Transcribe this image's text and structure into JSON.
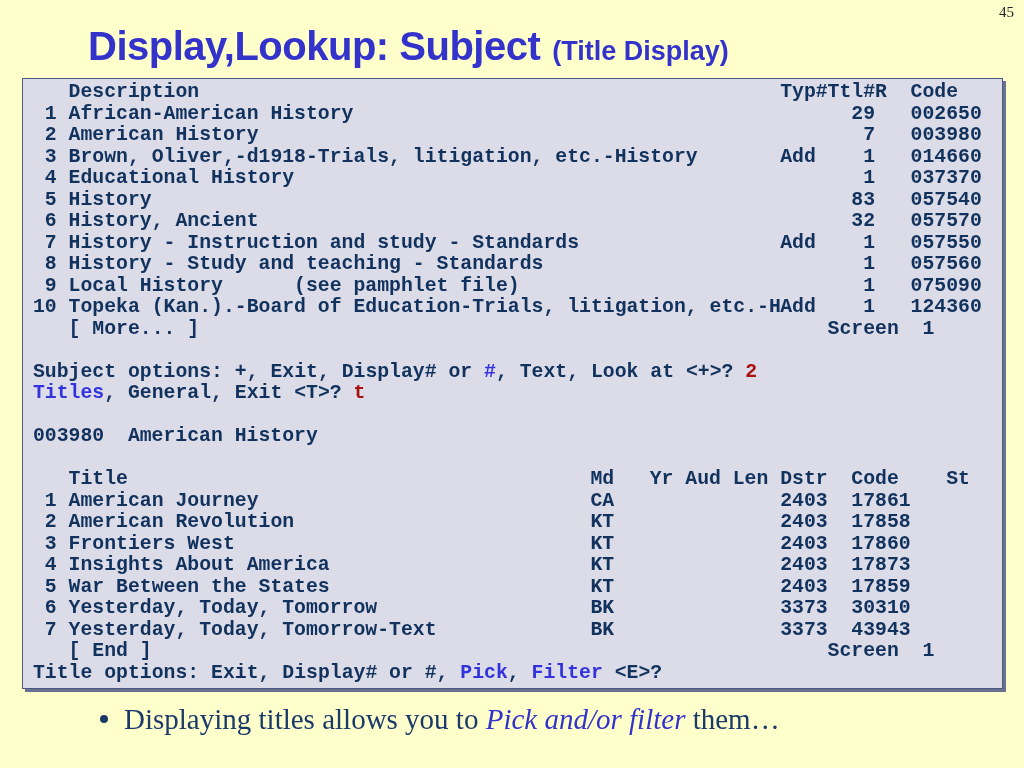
{
  "slide": {
    "page_number": "45",
    "title": "Display,Lookup: Subject",
    "subtitle": "(Title Display)"
  },
  "terminal": {
    "subject_table": {
      "columns": [
        "Description",
        "Typ",
        "#Ttl#R",
        "Code"
      ],
      "rows": [
        {
          "number": "1",
          "description": "African-American History",
          "titles": "29",
          "code": "002650"
        },
        {
          "number": "2",
          "description": "American History",
          "titles": "7",
          "code": "003980"
        },
        {
          "number": "3",
          "description": "Brown, Oliver,-d1918-Trials, litigation, etc.-History",
          "type": "Add",
          "titles": "1",
          "code": "014660"
        },
        {
          "number": "4",
          "description": "Educational History",
          "titles": "1",
          "code": "037370"
        },
        {
          "number": "5",
          "description": "History",
          "titles": "83",
          "code": "057540"
        },
        {
          "number": "6",
          "description": "History, Ancient",
          "titles": "32",
          "code": "057570"
        },
        {
          "number": "7",
          "description": "History - Instruction and study - Standards",
          "type": "Add",
          "titles": "1",
          "code": "057550"
        },
        {
          "number": "8",
          "description": "History - Study and teaching - Standards",
          "titles": "1",
          "code": "057560"
        },
        {
          "number": "9",
          "description": "Local History      (see pamphlet file)",
          "titles": "1",
          "code": "075090"
        },
        {
          "number": "10",
          "description": "Topeka (Kan.).-Board of Education-Trials, litigation, etc.-H",
          "type": "Add",
          "titles": "1",
          "code": "124360"
        }
      ],
      "footer": "[ More... ]",
      "screen_label": "Screen",
      "screen_number": "1"
    },
    "subject_prompt": [
      {
        "kind": "text",
        "text": "Subject options: +, Exit, Display# or "
      },
      {
        "kind": "option",
        "text": "#"
      },
      {
        "kind": "text",
        "text": ", Text, Look at <+>? "
      },
      {
        "kind": "input",
        "text": "2"
      }
    ],
    "view_prompt": [
      {
        "kind": "option",
        "text": "Titles"
      },
      {
        "kind": "text",
        "text": ", General, Exit <T>? "
      },
      {
        "kind": "input",
        "text": "t"
      }
    ],
    "selected_subject": {
      "code": "003980",
      "name": "American History"
    },
    "titles_table": {
      "columns": [
        "Title",
        "Md",
        "Yr",
        "Aud",
        "Len",
        "Dstr",
        "Code",
        "St"
      ],
      "rows": [
        {
          "number": "1",
          "title": "American Journey",
          "md": "CA",
          "dstr": "2403",
          "code": "17861"
        },
        {
          "number": "2",
          "title": "American Revolution",
          "md": "KT",
          "dstr": "2403",
          "code": "17858"
        },
        {
          "number": "3",
          "title": "Frontiers West",
          "md": "KT",
          "dstr": "2403",
          "code": "17860"
        },
        {
          "number": "4",
          "title": "Insights About America",
          "md": "KT",
          "dstr": "2403",
          "code": "17873"
        },
        {
          "number": "5",
          "title": "War Between the States",
          "md": "KT",
          "dstr": "2403",
          "code": "17859"
        },
        {
          "number": "6",
          "title": "Yesterday, Today, Tomorrow",
          "md": "BK",
          "dstr": "3373",
          "code": "30310"
        },
        {
          "number": "7",
          "title": "Yesterday, Today, Tomorrow-Text",
          "md": "BK",
          "dstr": "3373",
          "code": "43943"
        }
      ],
      "footer": "[ End ]",
      "screen_label": "Screen",
      "screen_number": "1"
    },
    "title_prompt": [
      {
        "kind": "text",
        "text": "Title options: Exit, Display# or #, "
      },
      {
        "kind": "option",
        "text": "Pick"
      },
      {
        "kind": "text",
        "text": ", "
      },
      {
        "kind": "option",
        "text": "Filter"
      },
      {
        "kind": "text",
        "text": " <E>?"
      }
    ]
  },
  "bullet": "Displaying titles allows you to *Pick and/or filter* them…"
}
